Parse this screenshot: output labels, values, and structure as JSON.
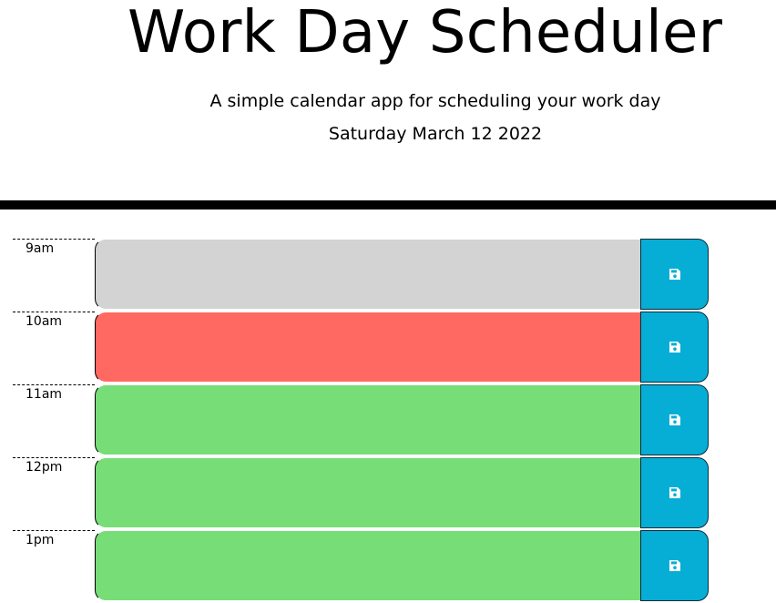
{
  "header": {
    "title": "Work Day Scheduler",
    "subtitle": "A simple calendar app for scheduling your work day",
    "current_day": "Saturday March 12 2022"
  },
  "colors": {
    "past": "#d3d3d3",
    "present": "#ff6961",
    "future": "#77dd77",
    "save_button": "#06aed5",
    "divider": "#000000"
  },
  "time_blocks": [
    {
      "hour": "9am",
      "text": "",
      "status": "past",
      "save_icon": "floppy-disk-icon"
    },
    {
      "hour": "10am",
      "text": "",
      "status": "present",
      "save_icon": "floppy-disk-icon"
    },
    {
      "hour": "11am",
      "text": "",
      "status": "future",
      "save_icon": "floppy-disk-icon"
    },
    {
      "hour": "12pm",
      "text": "",
      "status": "future",
      "save_icon": "floppy-disk-icon"
    },
    {
      "hour": "1pm",
      "text": "",
      "status": "future",
      "save_icon": "floppy-disk-icon"
    }
  ]
}
